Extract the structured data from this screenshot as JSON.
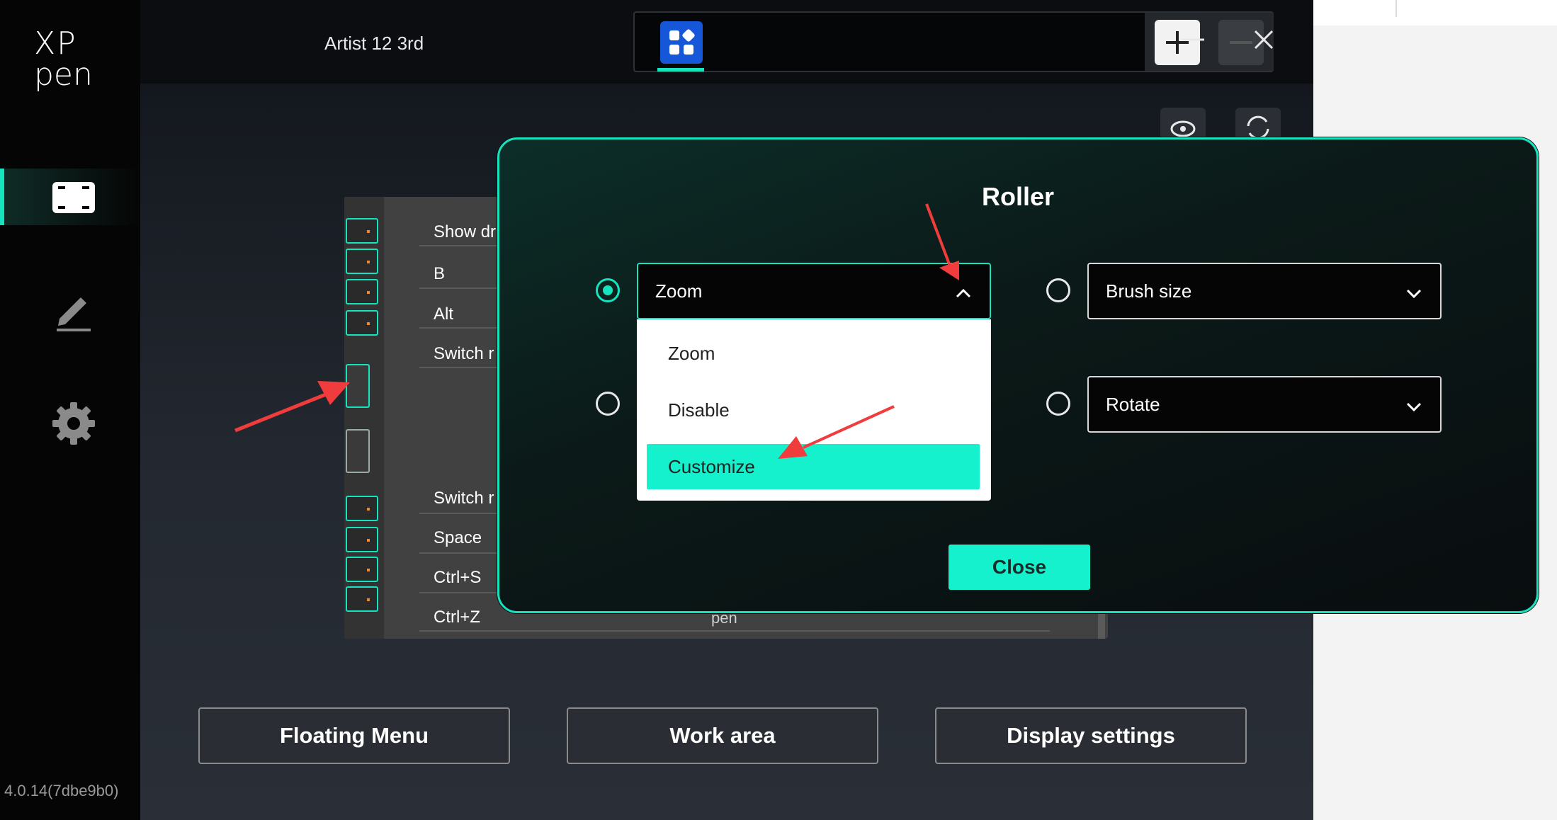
{
  "app": {
    "logo_line1": "XP",
    "logo_line2": "pen",
    "device_name": "Artist 12 3rd",
    "version": "4.0.14(7dbe9b0)",
    "accent_color": "#16e4bf"
  },
  "sidebar": {
    "items": [
      {
        "icon": "display-frame-icon",
        "active": true
      },
      {
        "icon": "pen-icon",
        "active": false
      },
      {
        "icon": "gear-icon",
        "active": false
      }
    ]
  },
  "toolbar": {
    "app_icon": "app-grid-icon",
    "add_icon": "plus-icon",
    "remove_icon": "minus-icon",
    "minimize_icon": "minimize-icon",
    "close_icon": "close-icon",
    "tools": [
      "eye-icon",
      "rotate-icon"
    ]
  },
  "express_keys": {
    "labels": [
      "Show dr",
      "B",
      "Alt",
      "Switch r",
      "Switch r",
      "Space",
      "Ctrl+S",
      "Ctrl+Z"
    ],
    "panel_brand": "pen"
  },
  "bottom_buttons": {
    "floating_menu": "Floating Menu",
    "work_area": "Work area",
    "display_settings": "Display settings"
  },
  "roller_dialog": {
    "title": "Roller",
    "option_1": {
      "value": "Zoom",
      "selected": true,
      "open": true
    },
    "option_2": {
      "value": "Brush size",
      "selected": false
    },
    "option_3": {
      "value": "Rotate",
      "selected": false
    },
    "dropdown_items": [
      "Zoom",
      "Disable",
      "Customize"
    ],
    "highlighted_item": "Customize",
    "close_label": "Close"
  }
}
